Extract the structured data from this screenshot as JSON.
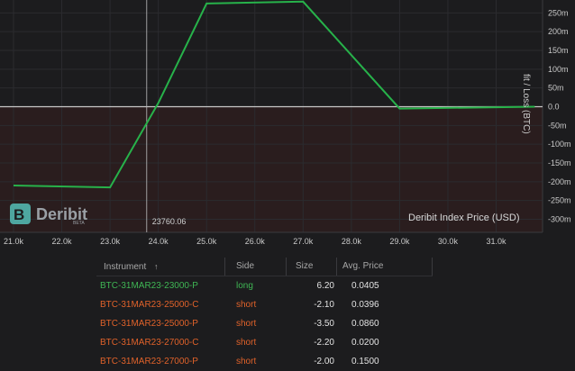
{
  "chart_data": {
    "type": "line",
    "title": "",
    "xlabel": "Deribit Index Price   (USD)",
    "ylabel": "fit / Loss   (BTC)",
    "x_ticks": [
      "21.0k",
      "22.0k",
      "23.0k",
      "24.0k",
      "25.0k",
      "26.0k",
      "27.0k",
      "28.0k",
      "29.0k",
      "30.0k",
      "31.0k"
    ],
    "y_ticks": [
      "250m",
      "200m",
      "150m",
      "100m",
      "50m",
      "0.0",
      "-50m",
      "-100m",
      "-150m",
      "-200m",
      "-250m",
      "-300m"
    ],
    "xlim": [
      21000,
      31800
    ],
    "ylim": [
      -305,
      285
    ],
    "series": [
      {
        "points": [
          [
            21000,
            -210
          ],
          [
            23000,
            -215
          ],
          [
            24000,
            10
          ],
          [
            25000,
            275
          ],
          [
            27000,
            280
          ],
          [
            29000,
            -5
          ],
          [
            31800,
            0
          ]
        ]
      }
    ],
    "crosshair": {
      "x": 23760.06,
      "label": "23760.06"
    },
    "colors": {
      "line": "#27b24a",
      "zero": "#c8c8c8",
      "loss_region": "#2a1d1e",
      "profit_region": "#1c1c1e"
    }
  },
  "logo": {
    "name": "Deribit",
    "sub": "BETA"
  },
  "table": {
    "headers": {
      "instrument": "Instrument",
      "sort_arrow": "↑",
      "side": "Side",
      "size": "Size",
      "avg_price": "Avg. Price"
    },
    "rows": [
      {
        "instrument": "BTC-31MAR23-23000-P",
        "side": "long",
        "size": "6.20",
        "avg": "0.0405",
        "color": "#3fb654"
      },
      {
        "instrument": "BTC-31MAR23-25000-C",
        "side": "short",
        "size": "-2.10",
        "avg": "0.0396",
        "color": "#e0622a"
      },
      {
        "instrument": "BTC-31MAR23-25000-P",
        "side": "short",
        "size": "-3.50",
        "avg": "0.0860",
        "color": "#e0622a"
      },
      {
        "instrument": "BTC-31MAR23-27000-C",
        "side": "short",
        "size": "-2.20",
        "avg": "0.0200",
        "color": "#e0622a"
      },
      {
        "instrument": "BTC-31MAR23-27000-P",
        "side": "short",
        "size": "-2.00",
        "avg": "0.1500",
        "color": "#e0622a"
      }
    ]
  }
}
